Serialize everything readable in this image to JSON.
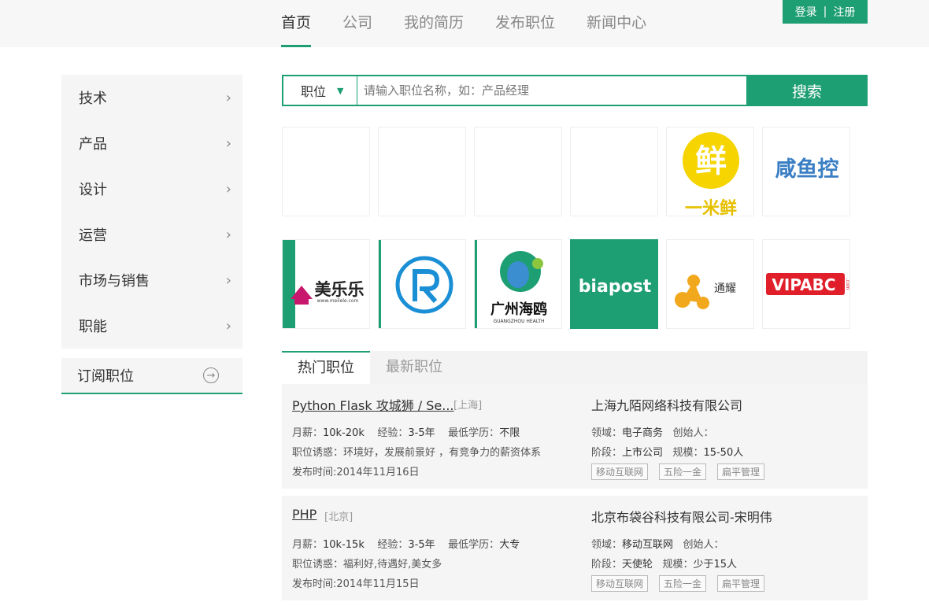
{
  "nav": {
    "items": [
      {
        "label": "首页",
        "active": true
      },
      {
        "label": "公司"
      },
      {
        "label": "我的简历"
      },
      {
        "label": "发布职位"
      },
      {
        "label": "新闻中心"
      }
    ],
    "login": "登录",
    "separator": "|",
    "register": "注册"
  },
  "sidebar": {
    "items": [
      "技术",
      "产品",
      "设计",
      "运营",
      "市场与销售",
      "职能"
    ],
    "subscribe": "订阅职位"
  },
  "search": {
    "type": "职位",
    "placeholder": "请输入职位名称，如：产品经理",
    "button": "搜索"
  },
  "logos": {
    "yimixian_char": "鲜",
    "yimixian": "一米鲜",
    "xianyukong": "咸鱼控",
    "meilele": "美乐乐",
    "meilele_url": "www.meilele.com",
    "guangzhou_haiou": "广州海鸥",
    "guangzhou_en": "GUANGZHOU HEALTH",
    "biapost": "biapost",
    "tongyao": "通耀",
    "vipabc": "VIPABC",
    "vipabc_com": ".com"
  },
  "tabs": [
    "热门职位",
    "最新职位"
  ],
  "jobs": [
    {
      "title": "Python Flask 攻城狮 / Se...",
      "city": "[上海]",
      "salary_label": "月薪：",
      "salary": "10k-20k",
      "exp_label": "经验：",
      "exp": "3-5年",
      "edu_label": "最低学历：",
      "edu": "不限",
      "perks": "职位诱惑：环境好，发展前景好 ，有竞争力的薪资体系",
      "posted": "发布时间:2014年11月16日",
      "company": "上海九陌网络科技有限公司",
      "domain_label": "领域：",
      "domain": "电子商务",
      "founder_label": "创始人：",
      "stage_label": "阶段：",
      "stage": "上市公司",
      "scale_label": "规模：",
      "scale": "15-50人",
      "tags": [
        "移动互联网",
        "五险一金",
        "扁平管理"
      ]
    },
    {
      "title": "PHP",
      "city": "[北京]",
      "salary_label": "月薪：",
      "salary": "10k-15k",
      "exp_label": "经验：",
      "exp": "3-5年",
      "edu_label": "最低学历：",
      "edu": "大专",
      "perks": "职位诱惑：福利好,待遇好,美女多",
      "posted": "发布时间:2014年11月15日",
      "company": "北京布袋谷科技有限公司-宋明伟",
      "domain_label": "领域：",
      "domain": "移动互联网",
      "founder_label": "创始人：",
      "stage_label": "阶段：",
      "stage": "天使轮",
      "scale_label": "规模：",
      "scale": "少于15人",
      "tags": [
        "移动互联网",
        "五险一金",
        "扁平管理"
      ]
    }
  ],
  "colors": {
    "accent": "#1e9e73",
    "vipabc_red": "#e01f2b",
    "yimixian_yellow": "#f5d400"
  }
}
